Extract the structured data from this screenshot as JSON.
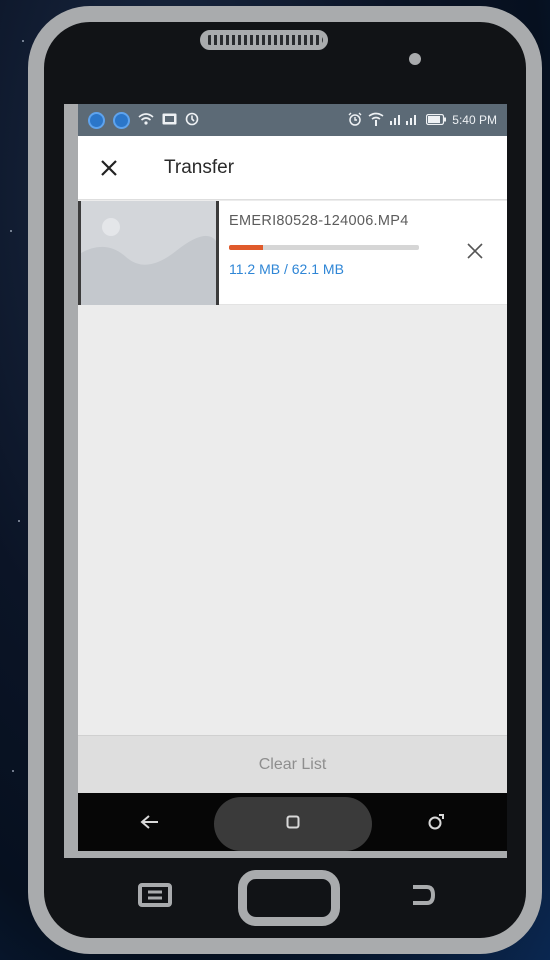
{
  "status_bar": {
    "time": "5:40 PM",
    "icons": [
      "app-notification-icon",
      "app-notification-icon",
      "wifi-icon",
      "cast-icon",
      "sync-icon",
      "alarm-icon",
      "wifi-signal-icon",
      "cell-signal-icon",
      "battery-icon"
    ]
  },
  "app_bar": {
    "title": "Transfer",
    "close_icon": "close-icon"
  },
  "transfers": [
    {
      "file_name": "EMERI80528-124006.MP4",
      "size_text": "11.2 MB / 62.1 MB",
      "progress": 0.18,
      "cancel_icon": "close-icon"
    }
  ],
  "footer": {
    "clear_label": "Clear List"
  },
  "nav_bar": {
    "buttons": [
      "back-icon",
      "home-icon",
      "recents-icon"
    ]
  },
  "colors": {
    "progress_fill": "#e05a2b",
    "size_text": "#2f86d6",
    "status_bar_bg": "#5c6a76"
  }
}
